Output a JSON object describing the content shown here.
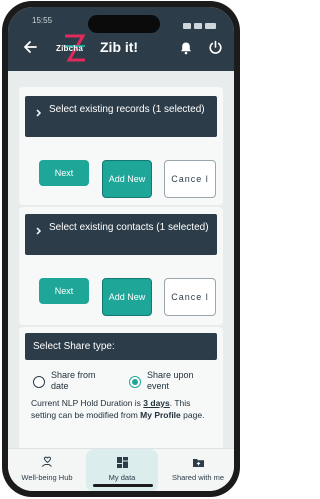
{
  "status": {
    "time": "15:55"
  },
  "header": {
    "logo_text": "Zibcha",
    "title": "Zib it!"
  },
  "records_card": {
    "header": "Select existing records (1 selected)",
    "next_label": "Next",
    "add_label": "Add New",
    "cancel_label": "Cance l"
  },
  "contacts_card": {
    "header": "Select existing contacts (1 selected)",
    "next_label": "Next",
    "add_label": "Add New",
    "cancel_label": "Cance l"
  },
  "share_card": {
    "header": "Select Share type:",
    "option_date": "Share from date",
    "option_event": "Share upon event",
    "selected": "Share upon event",
    "info_prefix": "Current NLP Hold Duration is",
    "info_duration": "3 days",
    "info_middle": ". This setting can be modified from",
    "info_link": "My Profile",
    "info_suffix": "page."
  },
  "bottom_nav": {
    "items": [
      {
        "label": "Well-being Hub",
        "icon": "heart-hand-icon"
      },
      {
        "label": "My data",
        "icon": "grid-icon",
        "active": true
      },
      {
        "label": "Shared with me",
        "icon": "folder-share-icon"
      }
    ]
  },
  "colors": {
    "header_bg": "#2c3d49",
    "accent": "#1ea698",
    "screen_bg": "#e8ecec"
  }
}
